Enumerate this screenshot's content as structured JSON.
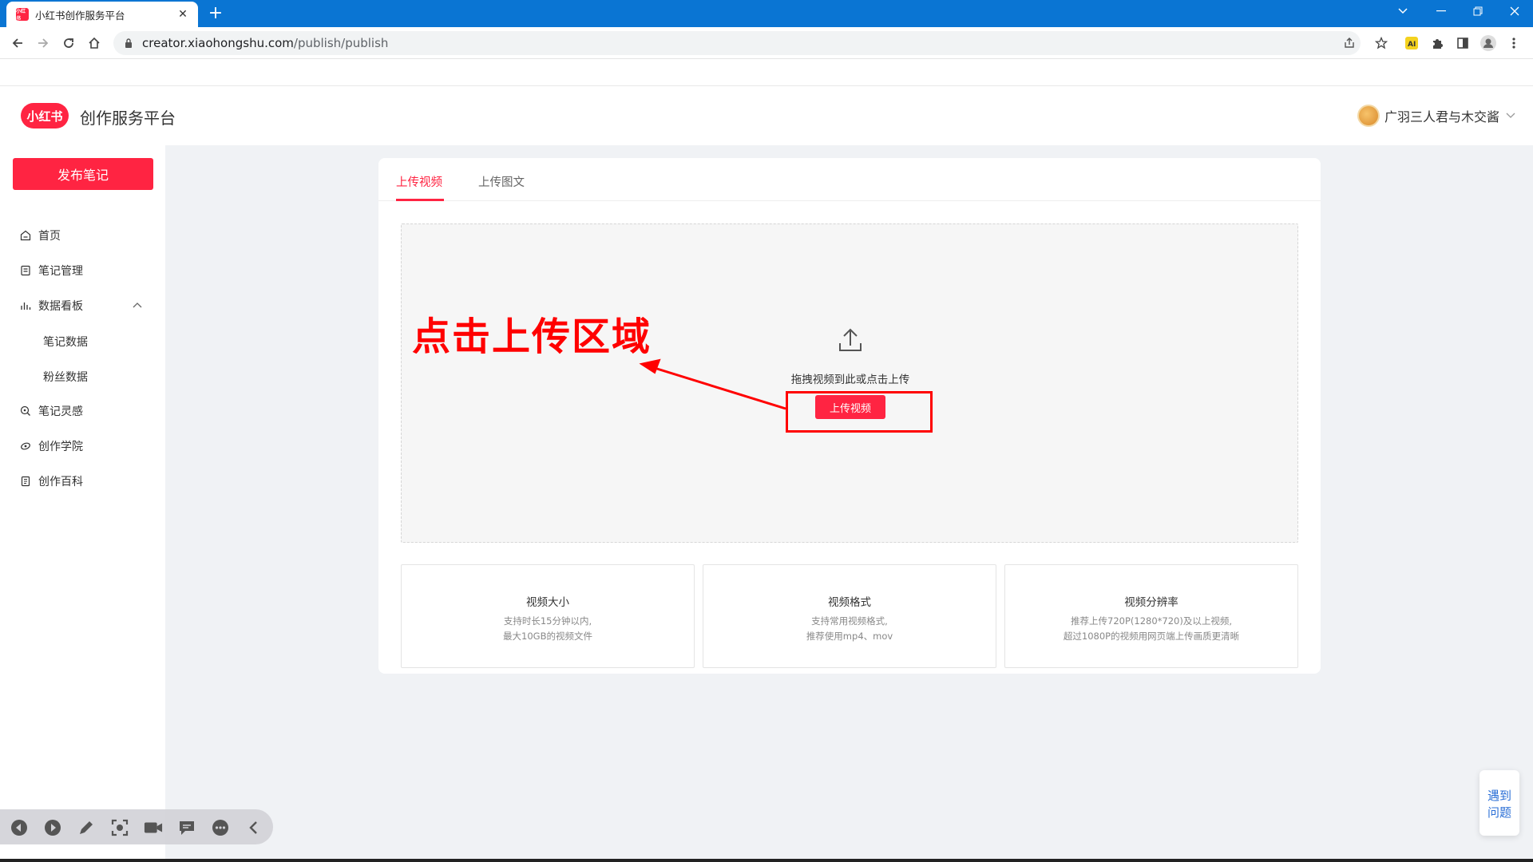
{
  "browser": {
    "tab_title": "小红书创作服务平台",
    "tab_favicon_text": "小红书",
    "url_host": "creator.xiaohongshu.com",
    "url_path": "/publish/publish"
  },
  "app": {
    "logo_text": "小红书",
    "brand_title": "创作服务平台",
    "username": "广羽三人君与木交酱"
  },
  "sidebar": {
    "publish_label": "发布笔记",
    "items": [
      {
        "label": "首页",
        "icon": "home-icon"
      },
      {
        "label": "笔记管理",
        "icon": "note-icon"
      },
      {
        "label": "数据看板",
        "icon": "chart-icon"
      },
      {
        "label": "笔记数据"
      },
      {
        "label": "粉丝数据"
      },
      {
        "label": "笔记灵感",
        "icon": "lightbulb-icon"
      },
      {
        "label": "创作学院",
        "icon": "academy-icon"
      },
      {
        "label": "创作百科",
        "icon": "wiki-icon"
      }
    ]
  },
  "content": {
    "tabs": [
      "上传视频",
      "上传图文"
    ],
    "drop_hint": "拖拽视频到此或点击上传",
    "upload_button": "上传视频",
    "info": [
      {
        "title": "视频大小",
        "lines": [
          "支持时长15分钟以内,",
          "最大10GB的视频文件"
        ]
      },
      {
        "title": "视频格式",
        "lines": [
          "支持常用视频格式,",
          "推荐使用mp4、mov"
        ]
      },
      {
        "title": "视频分辨率",
        "lines": [
          "推荐上传720P(1280*720)及以上视频,",
          "超过1080P的视频用网页端上传画质更清晰"
        ]
      }
    ]
  },
  "annotation": {
    "text": "点击上传区域",
    "color": "#ff0000"
  },
  "help": {
    "line1": "遇到",
    "line2": "问题"
  },
  "colors": {
    "brand": "#ff2442",
    "chrome_blue": "#0a75d3",
    "main_bg": "#f0f2f5"
  }
}
